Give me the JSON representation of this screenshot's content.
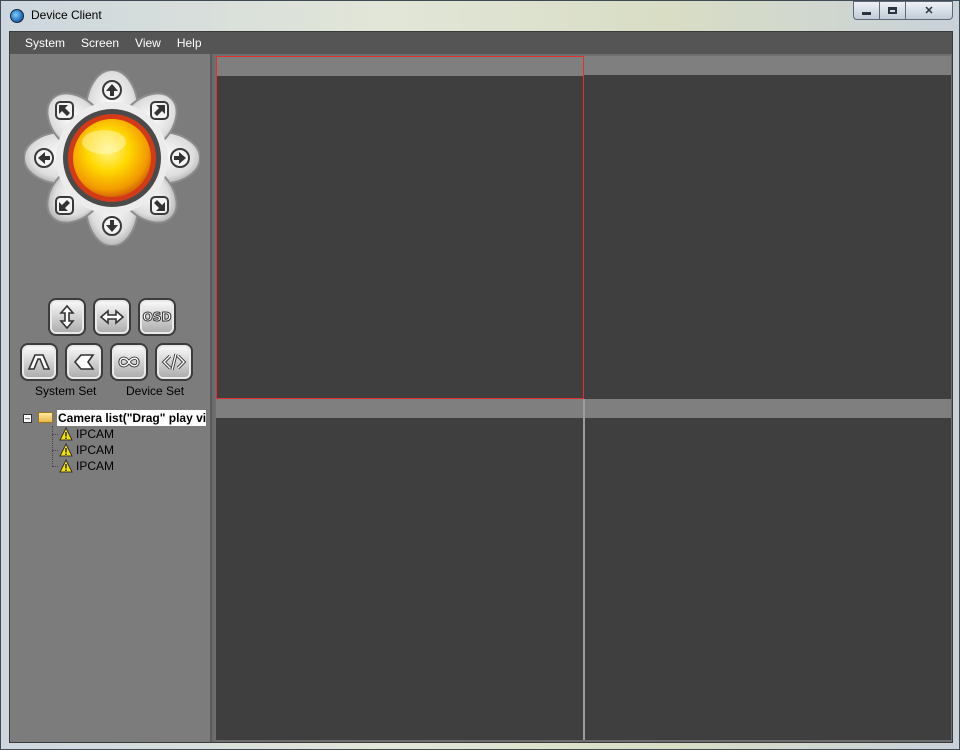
{
  "window": {
    "title": "Device Client"
  },
  "menu": [
    {
      "label": "System"
    },
    {
      "label": "Screen"
    },
    {
      "label": "View"
    },
    {
      "label": "Help"
    }
  ],
  "controls": {
    "osd_label": "OSD",
    "system_set_label": "System Set",
    "device_set_label": "Device Set"
  },
  "tree": {
    "root_label": "Camera list(\"Drag\" play vi",
    "items": [
      {
        "label": "IPCAM"
      },
      {
        "label": "IPCAM"
      },
      {
        "label": "IPCAM"
      }
    ]
  },
  "video": {
    "layout": "2x2",
    "selected_cell": 1,
    "accent_color": "#e03030",
    "cell_color": "#3f3f3f"
  }
}
